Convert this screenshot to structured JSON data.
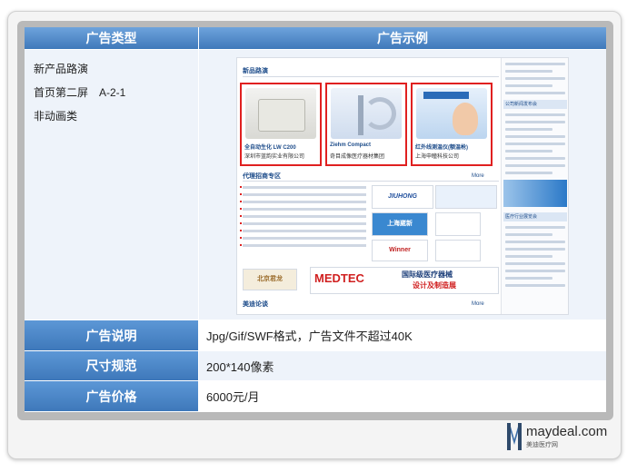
{
  "table": {
    "headers": [
      "广告类型",
      "广告示例"
    ],
    "ad_type_lines": [
      "新产品路演",
      "首页第二屏　A-2-1",
      "非动画类"
    ],
    "rows": [
      {
        "label": "广告说明",
        "value": "Jpg/Gif/SWF格式，广告文件不超过40K"
      },
      {
        "label": "尺寸规范",
        "value": "200*140像素"
      },
      {
        "label": "广告价格",
        "value": "6000元/月"
      }
    ]
  },
  "example": {
    "section_title": "新品路演",
    "products": [
      {
        "name": "全自动生化 LW C200",
        "company": "深圳市蓝韵实业有限公司"
      },
      {
        "name": "Ziehm Compact",
        "company": "奇目成像医疗器材集团"
      },
      {
        "name": "红外线测温仪(额温枪)",
        "company": "上海申瞳科技公司"
      }
    ],
    "agent_title": "代理招商专区",
    "more": "More",
    "bottom_title": "美迪论谈",
    "banner_text": "MEDTEC",
    "banner_cn": "国际级医疗器械",
    "banner_cn2": "设计及制造展",
    "logos": [
      "JIUHONG",
      "上海崴新",
      "Winner",
      "北京君龙"
    ],
    "sidebar_heads": [
      "公司新闻发布会",
      "医疗行业展览会"
    ]
  },
  "brand": {
    "site": "maydeal.com",
    "cn": "美迪医疗网"
  },
  "colors": {
    "header_blue": "#4f88c6",
    "highlight_red": "#e02020",
    "light_row": "#eef3fa"
  }
}
